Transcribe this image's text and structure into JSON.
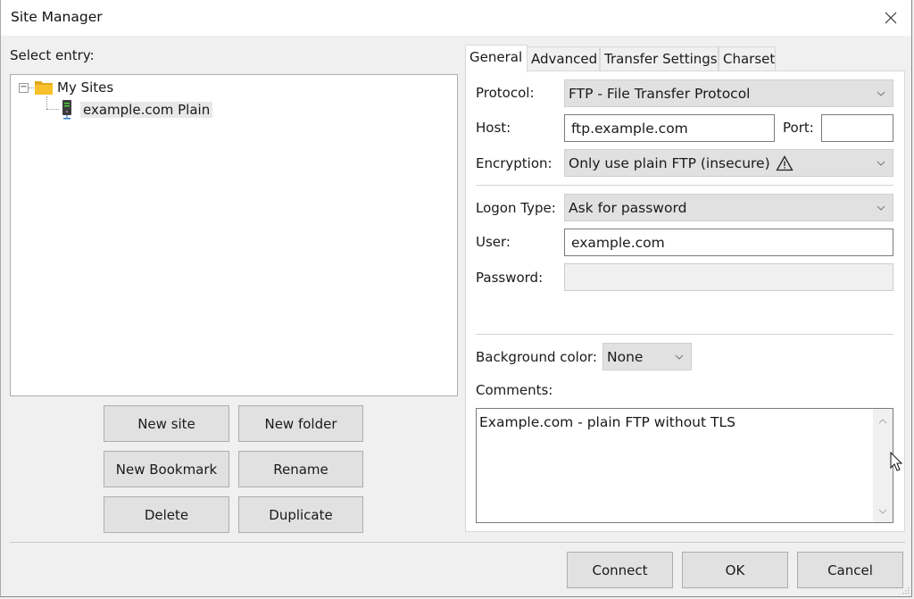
{
  "window": {
    "title": "Site Manager"
  },
  "left": {
    "select_entry_label": "Select entry:",
    "tree": {
      "root": {
        "label": "My Sites",
        "icon": "folder-icon",
        "expanded": true
      },
      "children": [
        {
          "label": "example.com Plain",
          "icon": "server-icon",
          "selected": true
        }
      ]
    },
    "buttons": {
      "new_site": "New site",
      "new_folder": "New folder",
      "new_bookmark": "New Bookmark",
      "rename": "Rename",
      "delete": "Delete",
      "duplicate": "Duplicate"
    }
  },
  "tabs": [
    {
      "label": "General",
      "active": true
    },
    {
      "label": "Advanced",
      "active": false
    },
    {
      "label": "Transfer Settings",
      "active": false
    },
    {
      "label": "Charset",
      "active": false
    }
  ],
  "general": {
    "protocol": {
      "label": "Protocol:",
      "value": "FTP - File Transfer Protocol"
    },
    "host": {
      "label": "Host:",
      "value": "ftp.example.com"
    },
    "port": {
      "label": "Port:",
      "value": ""
    },
    "encryption": {
      "label": "Encryption:",
      "value": "Only use plain FTP (insecure)",
      "icon": "warning-icon"
    },
    "logon_type": {
      "label": "Logon Type:",
      "value": "Ask for password"
    },
    "user": {
      "label": "User:",
      "value": "example.com"
    },
    "password": {
      "label": "Password:",
      "value": "",
      "disabled": true
    },
    "background_color": {
      "label": "Background color:",
      "value": "None"
    },
    "comments": {
      "label": "Comments:",
      "value": "Example.com - plain FTP without TLS"
    }
  },
  "footer": {
    "connect": "Connect",
    "ok": "OK",
    "cancel": "Cancel"
  }
}
